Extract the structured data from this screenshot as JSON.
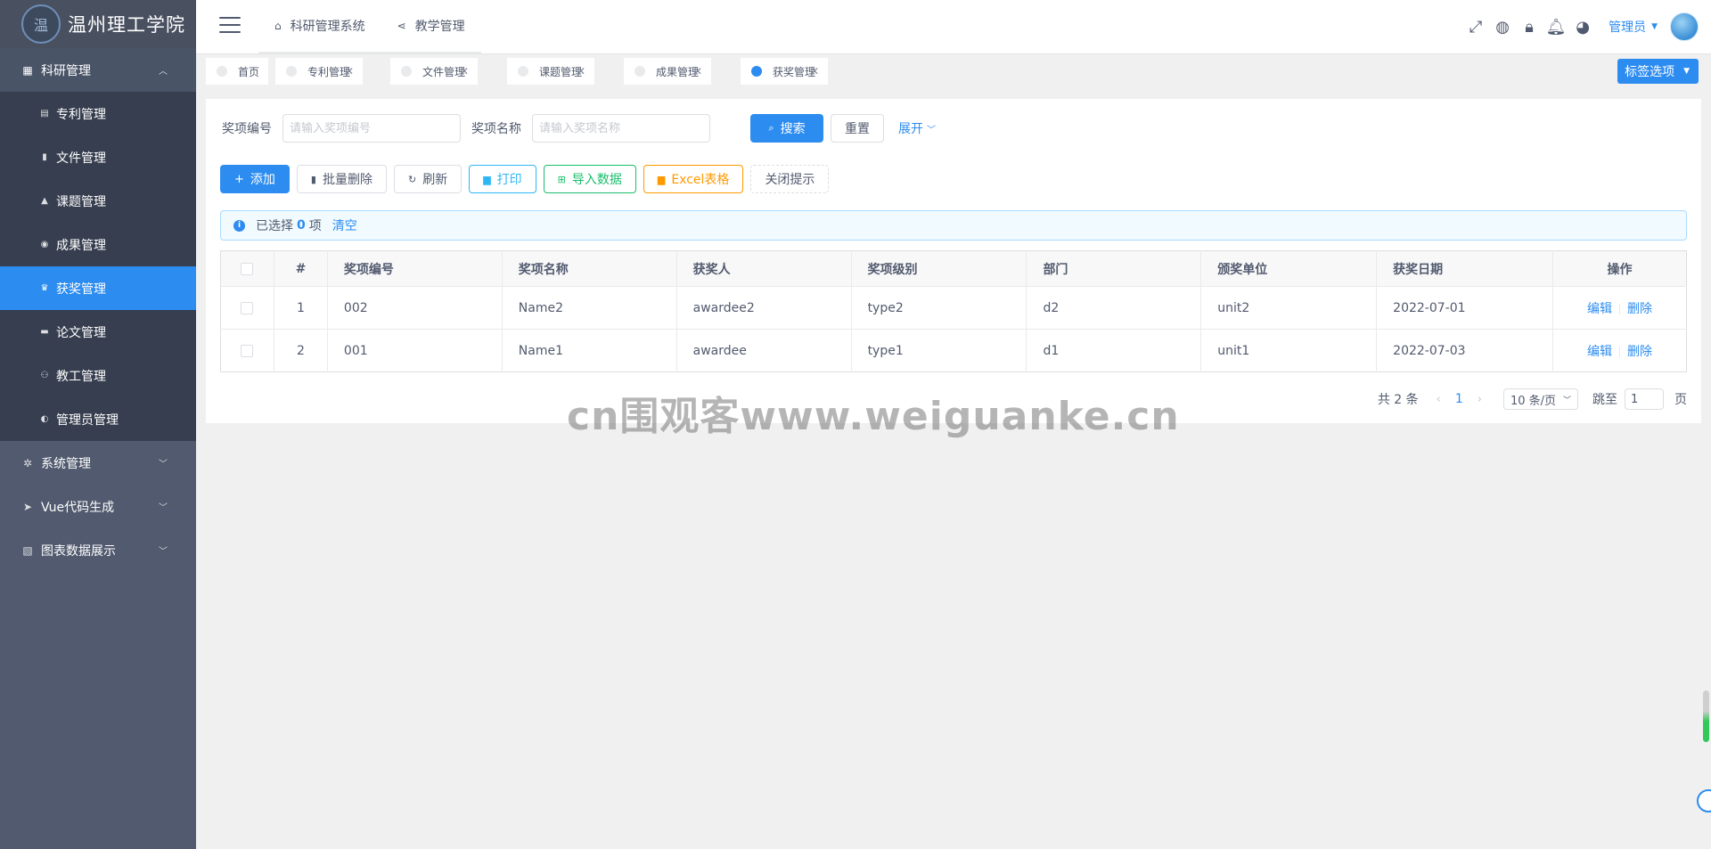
{
  "logo": {
    "seal": "温",
    "name": "温州理工学院"
  },
  "sidebar": {
    "open_group": {
      "label": "科研管理",
      "icon": "grid-icon"
    },
    "sub_items": [
      {
        "label": "专利管理",
        "icon": "document-icon",
        "active": false
      },
      {
        "label": "文件管理",
        "icon": "file-icon",
        "active": false
      },
      {
        "label": "课题管理",
        "icon": "flask-icon",
        "active": false
      },
      {
        "label": "成果管理",
        "icon": "circle-icon",
        "active": false
      },
      {
        "label": "获奖管理",
        "icon": "trophy-icon",
        "active": true
      },
      {
        "label": "论文管理",
        "icon": "book-icon",
        "active": false
      },
      {
        "label": "教工管理",
        "icon": "people-icon",
        "active": false
      },
      {
        "label": "管理员管理",
        "icon": "user-circle-icon",
        "active": false
      }
    ],
    "groups": [
      {
        "label": "系统管理",
        "icon": "gear-icon"
      },
      {
        "label": "Vue代码生成",
        "icon": "send-icon"
      },
      {
        "label": "图表数据展示",
        "icon": "chart-icon"
      }
    ]
  },
  "header": {
    "nav": [
      {
        "label": "科研管理系统",
        "icon": "home-icon"
      },
      {
        "label": "教学管理",
        "icon": "share-icon"
      }
    ],
    "user_name": "管理员"
  },
  "tabs": [
    {
      "label": "首页",
      "closable": false,
      "active": false
    },
    {
      "label": "专利管理",
      "closable": true,
      "active": false
    },
    {
      "label": "文件管理",
      "closable": true,
      "active": false
    },
    {
      "label": "课题管理",
      "closable": true,
      "active": false
    },
    {
      "label": "成果管理",
      "closable": true,
      "active": false
    },
    {
      "label": "获奖管理",
      "closable": true,
      "active": true
    }
  ],
  "tag_options_label": "标签选项",
  "search": {
    "code_label": "奖项编号",
    "code_placeholder": "请输入奖项编号",
    "name_label": "奖项名称",
    "name_placeholder": "请输入奖项名称",
    "search_label": "搜索",
    "reset_label": "重置",
    "expand_label": "展开"
  },
  "toolbar": {
    "add": "添加",
    "batch_delete": "批量删除",
    "refresh": "刷新",
    "print": "打印",
    "import": "导入数据",
    "excel": "Excel表格",
    "close_tip": "关闭提示"
  },
  "selection": {
    "prefix": "已选择",
    "count": "0",
    "suffix": "项",
    "clear": "清空"
  },
  "table": {
    "columns": [
      "#",
      "奖项编号",
      "奖项名称",
      "获奖人",
      "奖项级别",
      "部门",
      "颁奖单位",
      "获奖日期",
      "操作"
    ],
    "rows": [
      {
        "idx": "1",
        "code": "002",
        "name": "Name2",
        "awardee": "awardee2",
        "level": "type2",
        "dept": "d2",
        "unit": "unit2",
        "date": "2022-07-01"
      },
      {
        "idx": "2",
        "code": "001",
        "name": "Name1",
        "awardee": "awardee",
        "level": "type1",
        "dept": "d1",
        "unit": "unit1",
        "date": "2022-07-03"
      }
    ],
    "edit_label": "编辑",
    "delete_label": "删除"
  },
  "pager": {
    "total": "共 2 条",
    "current": "1",
    "page_size": "10 条/页",
    "jump_label": "跳至",
    "jump_value": "1",
    "page_suffix": "页"
  },
  "watermark": "cn围观客www.weiguanke.cn",
  "colors": {
    "primary": "#2d8cf0",
    "sidebar": "#515a6e",
    "sidebar_sub": "#363e4f",
    "success": "#19be6b",
    "warning": "#ff9900",
    "info": "#2db7f5"
  }
}
